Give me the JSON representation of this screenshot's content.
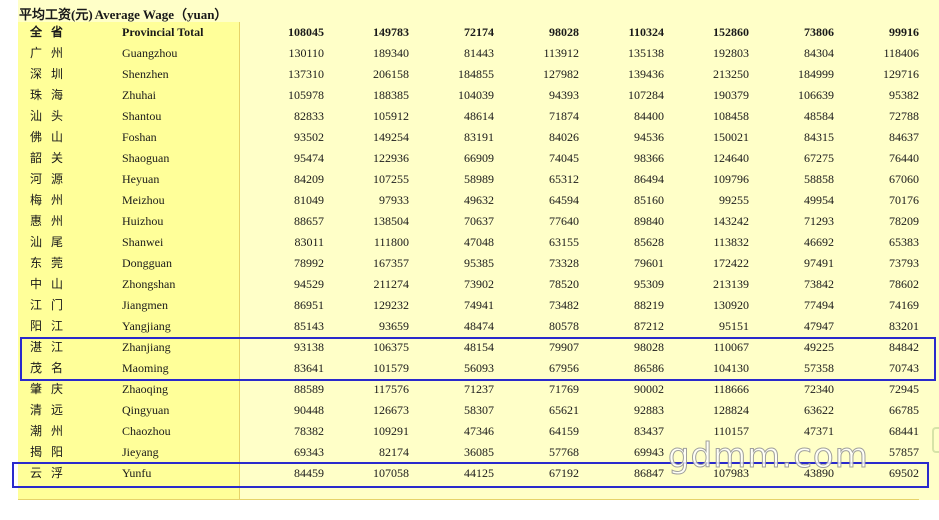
{
  "title": {
    "cn": "平均工资(元)",
    "en": "Average Wage（yuan）"
  },
  "rows": [
    {
      "cn": "全省",
      "en": "Provincial Total",
      "values": [
        "108045",
        "149783",
        "72174",
        "98028",
        "110324",
        "152860",
        "73806",
        "99916"
      ],
      "total": true
    },
    {
      "cn": "广州",
      "en": "Guangzhou",
      "values": [
        "130110",
        "189340",
        "81443",
        "113912",
        "135138",
        "192803",
        "84304",
        "118406"
      ]
    },
    {
      "cn": "深圳",
      "en": "Shenzhen",
      "values": [
        "137310",
        "206158",
        "184855",
        "127982",
        "139436",
        "213250",
        "184999",
        "129716"
      ]
    },
    {
      "cn": "珠海",
      "en": "Zhuhai",
      "values": [
        "105978",
        "188385",
        "104039",
        "94393",
        "107284",
        "190379",
        "106639",
        "95382"
      ]
    },
    {
      "cn": "汕头",
      "en": "Shantou",
      "values": [
        "82833",
        "105912",
        "48614",
        "71874",
        "84400",
        "108458",
        "48584",
        "72788"
      ]
    },
    {
      "cn": "佛山",
      "en": "Foshan",
      "values": [
        "93502",
        "149254",
        "83191",
        "84026",
        "94536",
        "150021",
        "84315",
        "84637"
      ]
    },
    {
      "cn": "韶关",
      "en": "Shaoguan",
      "values": [
        "95474",
        "122936",
        "66909",
        "74045",
        "98366",
        "124640",
        "67275",
        "76440"
      ]
    },
    {
      "cn": "河源",
      "en": "Heyuan",
      "values": [
        "84209",
        "107255",
        "58989",
        "65312",
        "86494",
        "109796",
        "58858",
        "67060"
      ]
    },
    {
      "cn": "梅州",
      "en": "Meizhou",
      "values": [
        "81049",
        "97933",
        "49632",
        "64594",
        "85160",
        "99255",
        "49954",
        "70176"
      ]
    },
    {
      "cn": "惠州",
      "en": "Huizhou",
      "values": [
        "88657",
        "138504",
        "70637",
        "77640",
        "89840",
        "143242",
        "71293",
        "78209"
      ]
    },
    {
      "cn": "汕尾",
      "en": "Shanwei",
      "values": [
        "83011",
        "111800",
        "47048",
        "63155",
        "85628",
        "113832",
        "46692",
        "65383"
      ]
    },
    {
      "cn": "东莞",
      "en": "Dongguan",
      "values": [
        "78992",
        "167357",
        "95385",
        "73328",
        "79601",
        "172422",
        "97491",
        "73793"
      ]
    },
    {
      "cn": "中山",
      "en": "Zhongshan",
      "values": [
        "94529",
        "211274",
        "73902",
        "78520",
        "95309",
        "213139",
        "73842",
        "78602"
      ]
    },
    {
      "cn": "江门",
      "en": "Jiangmen",
      "values": [
        "86951",
        "129232",
        "74941",
        "73482",
        "88219",
        "130920",
        "77494",
        "74169"
      ]
    },
    {
      "cn": "阳江",
      "en": "Yangjiang",
      "values": [
        "85143",
        "93659",
        "48474",
        "80578",
        "87212",
        "95151",
        "47947",
        "83201"
      ]
    },
    {
      "cn": "湛江",
      "en": "Zhanjiang",
      "values": [
        "93138",
        "106375",
        "48154",
        "79907",
        "98028",
        "110067",
        "49225",
        "84842"
      ]
    },
    {
      "cn": "茂名",
      "en": "Maoming",
      "values": [
        "83641",
        "101579",
        "56093",
        "67956",
        "86586",
        "104130",
        "57358",
        "70743"
      ]
    },
    {
      "cn": "肇庆",
      "en": "Zhaoqing",
      "values": [
        "88589",
        "117576",
        "71237",
        "71769",
        "90002",
        "118666",
        "72340",
        "72945"
      ]
    },
    {
      "cn": "清远",
      "en": "Qingyuan",
      "values": [
        "90448",
        "126673",
        "58307",
        "65621",
        "92883",
        "128824",
        "63622",
        "66785"
      ]
    },
    {
      "cn": "潮州",
      "en": "Chaozhou",
      "values": [
        "78382",
        "109291",
        "47346",
        "64159",
        "83437",
        "110157",
        "47371",
        "68441"
      ]
    },
    {
      "cn": "揭阳",
      "en": "Jieyang",
      "values": [
        "69343",
        "82174",
        "36085",
        "57768",
        "69943",
        "",
        "",
        "57857"
      ]
    },
    {
      "cn": "云浮",
      "en": "Yunfu",
      "values": [
        "84459",
        "107058",
        "44125",
        "67192",
        "86847",
        "107983",
        "43890",
        "69502"
      ]
    }
  ],
  "watermark": "gdmm.com"
}
